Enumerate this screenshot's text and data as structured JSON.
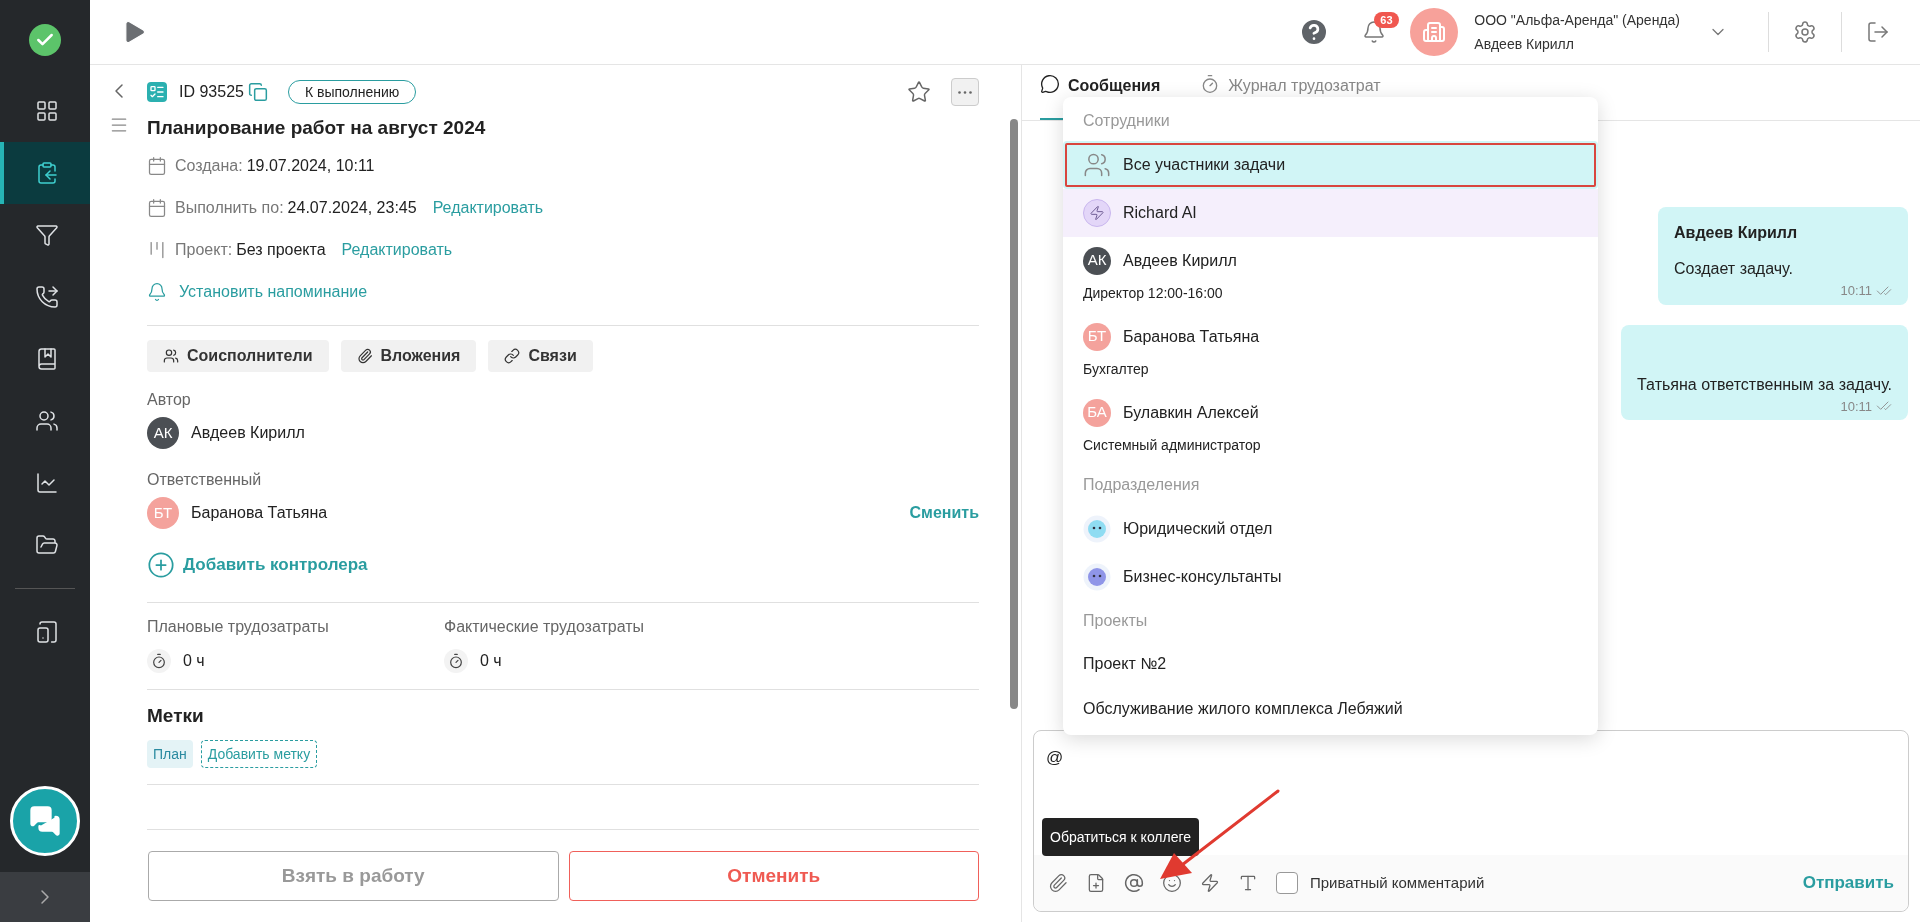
{
  "sidebar": {
    "items": [
      {
        "selected": false
      },
      {
        "selected": true
      },
      {
        "selected": false
      },
      {
        "selected": false
      },
      {
        "selected": false
      },
      {
        "selected": false
      },
      {
        "selected": false
      },
      {
        "selected": false
      },
      {
        "selected": false
      }
    ]
  },
  "header": {
    "notifications": "63",
    "company": "ООО \"Альфа-Аренда\" (Аренда)",
    "user": "Авдеев Кирилл"
  },
  "task": {
    "id": "ID 93525",
    "status": "К выполнению",
    "title": "Планирование работ на август 2024",
    "fields": [
      {
        "kind": "date",
        "label": "Создана:",
        "value": "19.07.2024, 10:11"
      },
      {
        "kind": "date",
        "label": "Выполнить по:",
        "value": "24.07.2024, 23:45",
        "link": "Редактировать"
      },
      {
        "kind": "project",
        "label": "Проект:",
        "value": "Без проекта",
        "link": "Редактировать"
      }
    ],
    "reminder": "Установить напоминание",
    "actions": [
      "Соисполнители",
      "Вложения",
      "Связи"
    ],
    "people": [
      {
        "label": "Автор",
        "initials": "АК",
        "name": "Авдеев Кирилл",
        "color": "#4b4f54"
      },
      {
        "label": "Ответственный",
        "initials": "БТ",
        "name": "Баранова Татьяна",
        "color": "#f4a29c",
        "action": "Сменить"
      }
    ],
    "add_controller": "Добавить контролера",
    "labor": [
      {
        "label": "Плановые трудозатраты",
        "value": "0 ч"
      },
      {
        "label": "Фактические трудозатраты",
        "value": "0 ч"
      }
    ],
    "tags_title": "Метки",
    "tags": [
      "План"
    ],
    "add_tag": "Добавить метку",
    "buttons": [
      {
        "label": "Взять в работу",
        "kind": "secondary"
      },
      {
        "label": "Отменить",
        "kind": "danger"
      }
    ]
  },
  "tabs": [
    {
      "label": "Сообщения",
      "selected": true
    },
    {
      "label": "Журнал трудозатрат",
      "selected": false
    }
  ],
  "messages": [
    {
      "author": "Авдеев Кирилл",
      "text": "Создает задачу.",
      "time": "10:11"
    },
    {
      "text": "Татьяна ответственным за задачу.",
      "time": "10:11"
    }
  ],
  "mentions": [
    {
      "title": "Сотрудники",
      "items": [
        {
          "kind": "group",
          "name": "Все участники задачи",
          "selected": true
        },
        {
          "kind": "ai",
          "name": "Richard AI",
          "selected": false
        },
        {
          "kind": "person",
          "name": "Авдеев Кирилл",
          "initials": "АК",
          "color": "#4b4f54",
          "subtitle": "Директор 12:00-16:00",
          "selected": false
        },
        {
          "kind": "person",
          "name": "Баранова Татьяна",
          "initials": "БТ",
          "color": "#f4a29c",
          "subtitle": "Бухгалтер",
          "selected": false
        },
        {
          "kind": "person",
          "name": "Булавкин Алексей",
          "initials": "БА",
          "color": "#f4a29c",
          "subtitle": "Системный администратор",
          "selected": false
        }
      ]
    },
    {
      "title": "Подразделения",
      "items": [
        {
          "kind": "department",
          "name": "Юридический отдел",
          "color": "#8fdcf2",
          "selected": false
        },
        {
          "kind": "department",
          "name": "Бизнес-консультанты",
          "color": "#8f95e8",
          "selected": false
        }
      ]
    },
    {
      "title": "Проекты",
      "items": [
        {
          "kind": "project",
          "name": "Проект №2",
          "selected": false
        },
        {
          "kind": "project",
          "name": "Обслуживание жилого комплекса Лебяжий",
          "selected": false
        }
      ]
    }
  ],
  "composer": {
    "value": "@",
    "tooltip": "Обратиться к коллеге",
    "private": {
      "label": "Приватный комментарий",
      "checked": false
    },
    "send": "Отправить"
  }
}
